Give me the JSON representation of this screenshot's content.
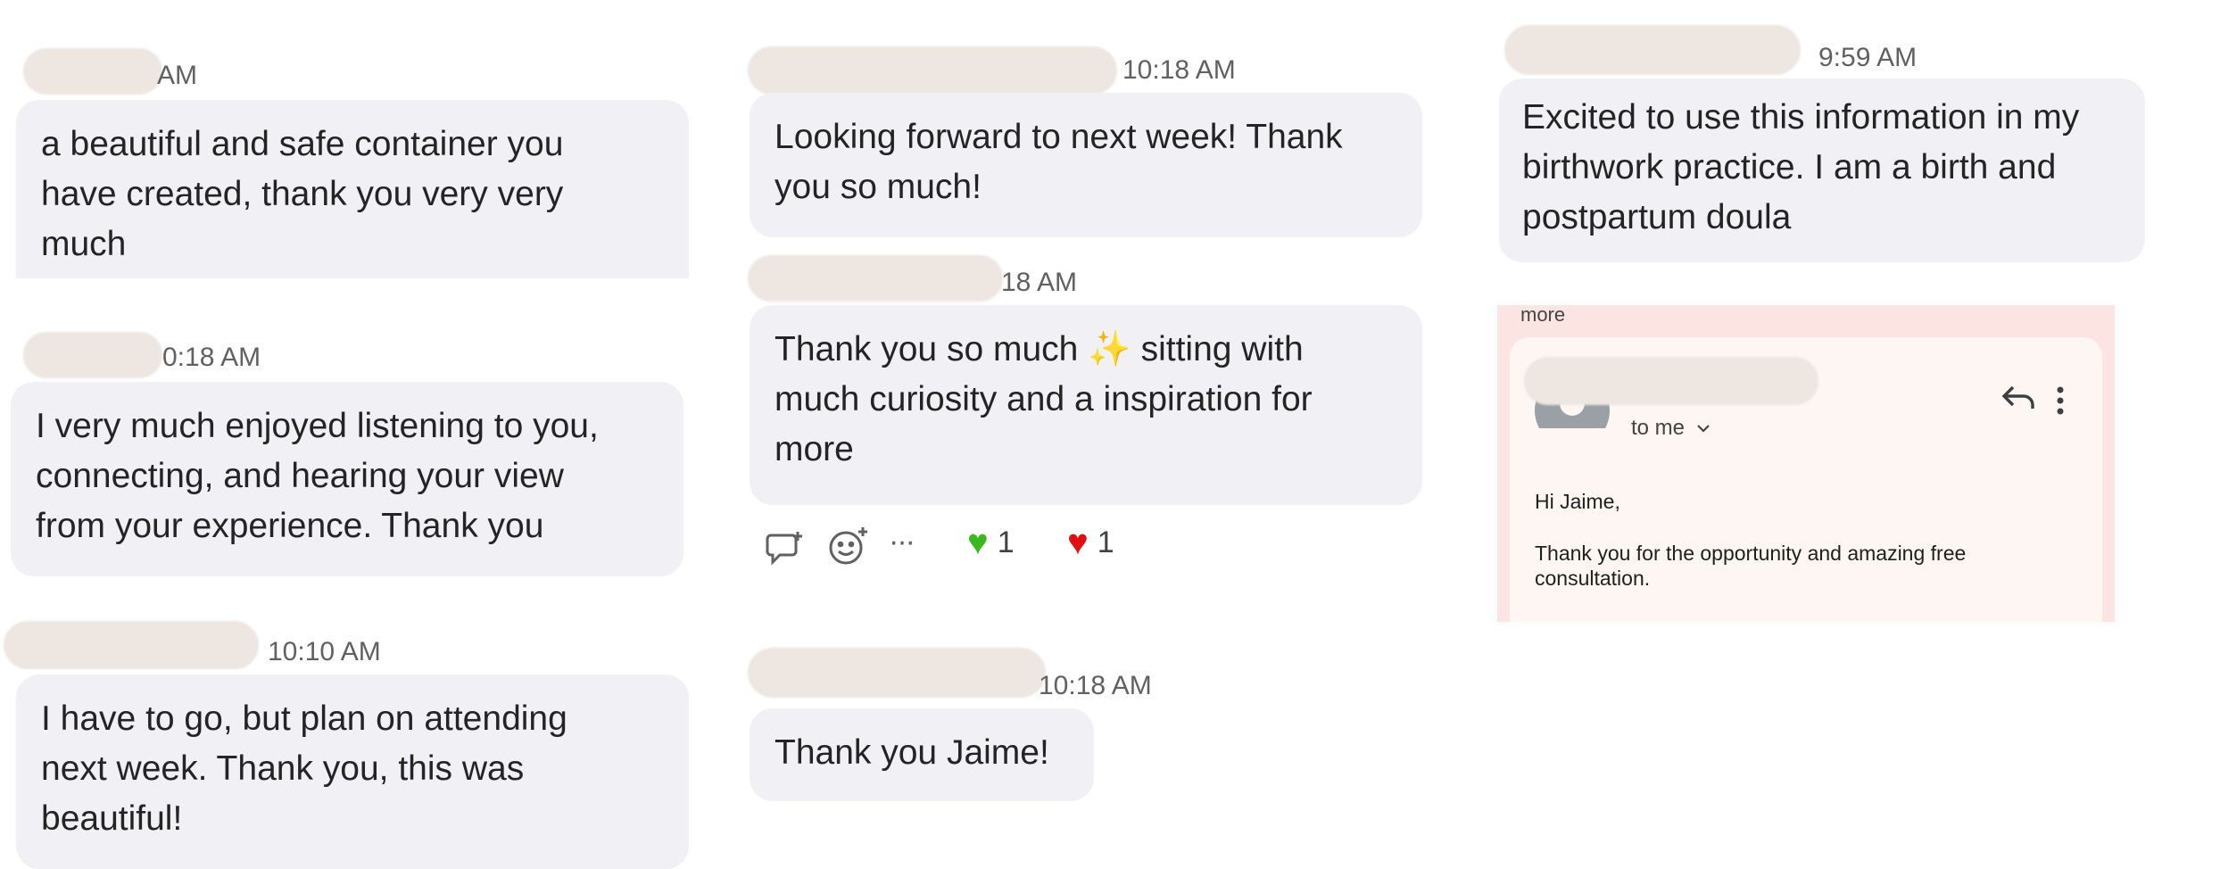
{
  "col1": {
    "msg1": {
      "time": "AM",
      "text": "a beautiful and safe container you\nhave created, thank you very very\nmuch"
    },
    "msg2": {
      "time": "0:18 AM",
      "text": "I very much enjoyed listening to you,\nconnecting, and hearing your view\nfrom your experience. Thank you"
    },
    "msg3": {
      "time": "10:10 AM",
      "text": "I have to go, but plan on attending\nnext week. Thank you, this was\nbeautiful!"
    }
  },
  "col2": {
    "msg1": {
      "time": "10:18 AM",
      "text": "Looking forward to next week! Thank\nyou so much!"
    },
    "msg2": {
      "time": "18 AM",
      "text_before": "Thank you so much ",
      "emoji": "✨",
      "text_after": " sitting with\nmuch curiosity and a inspiration for\nmore"
    },
    "reactions": {
      "reply_icon": "reply-icon",
      "add_reaction_icon": "add-reaction-icon",
      "more_icon": "more-options-icon",
      "more_glyph": "···",
      "green_heart": {
        "emoji": "💚",
        "count": "1"
      },
      "red_heart": {
        "emoji": "❤",
        "count": "1"
      }
    },
    "msg3": {
      "time": "10:18 AM",
      "text": "Thank you Jaime!"
    }
  },
  "col3": {
    "msg1": {
      "time": "9:59 AM",
      "text": "Excited to use this information in my\nbirthwork practice. I am a birth and\npostpartum doula"
    },
    "email": {
      "more_label": "more",
      "to_me": "to me",
      "greeting": "Hi Jaime,",
      "body": "Thank you for the opportunity and amazing free\nconsultation."
    }
  },
  "colors": {
    "bubble": "#f1f1f5",
    "redaction": "#ede6e1",
    "email_bg": "#fbe4e2",
    "email_inner": "#fdf6f2"
  }
}
